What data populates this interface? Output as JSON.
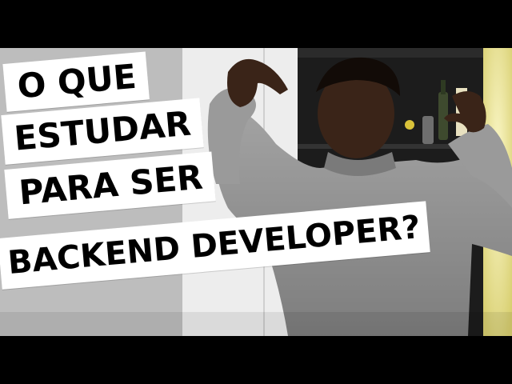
{
  "thumbnail": {
    "caption_lines": [
      "O QUE",
      "ESTUDAR",
      "PARA SER",
      "BACKEND DEVELOPER?"
    ]
  },
  "colors": {
    "letterbox": "#000000",
    "caption_background": "#ffffff",
    "caption_text": "#000000",
    "sweater": "#8f8f8f",
    "wall": "#d9d9d9",
    "shelf": "#1a1a1a",
    "light": "#f2eaa0"
  }
}
